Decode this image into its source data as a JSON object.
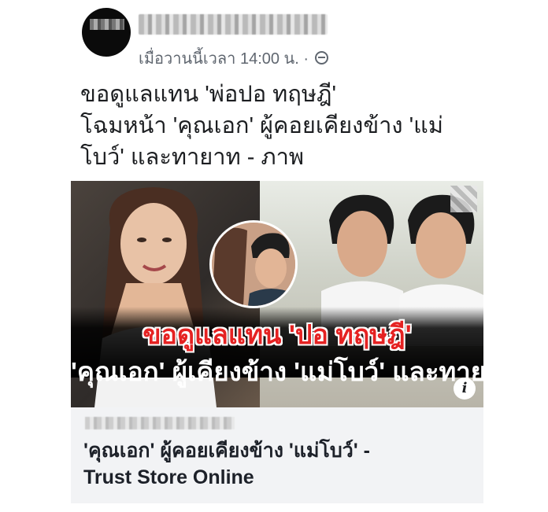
{
  "post": {
    "timestamp": "เมื่อวานนี้เวลา 14:00 น.",
    "separator": "·",
    "text_lines": [
      "ขอดูแลแทน 'พ่อปอ ทฤษฎี'",
      "โฉมหน้า 'คุณเอก' ผู้คอยเคียงข้าง 'แม่",
      "โบว์' และทายาท - ภาพ"
    ]
  },
  "link_card": {
    "image_headline_1": "ขอดูแลแทน 'ปอ ทฤษฎี'",
    "image_headline_2": "'คุณเอก' ผู้เคียงข้าง 'แม่โบว์' และทายาท",
    "info_icon_glyph": "i",
    "title_lines": [
      "'คุณเอก' ผู้คอยเคียงข้าง 'แม่โบว์' -",
      "Trust Store Online"
    ]
  },
  "icons": [
    "globe-icon",
    "info-icon"
  ]
}
